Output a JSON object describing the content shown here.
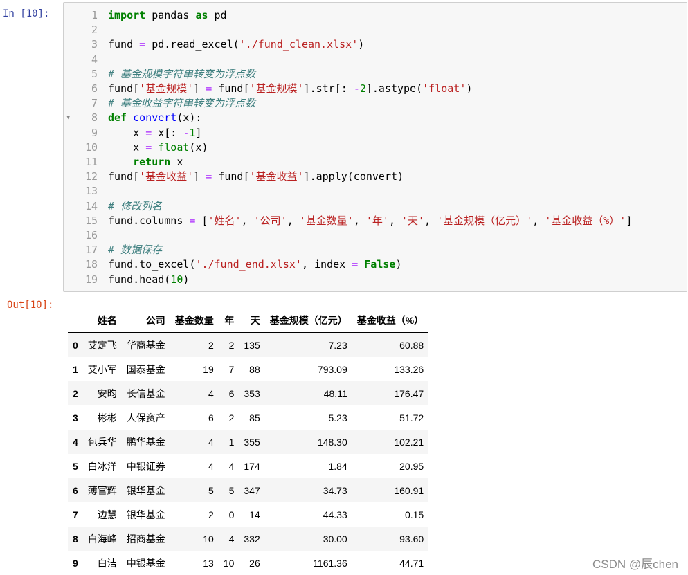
{
  "in_prompt": "In  [10]:",
  "out_prompt": "Out[10]:",
  "code_lines": [
    [
      {
        "t": "import",
        "c": "kw"
      },
      {
        "t": " pandas ",
        "c": "tx"
      },
      {
        "t": "as",
        "c": "kw"
      },
      {
        "t": " pd",
        "c": "tx"
      }
    ],
    [],
    [
      {
        "t": "fund ",
        "c": "tx"
      },
      {
        "t": "=",
        "c": "op"
      },
      {
        "t": " pd.read_excel(",
        "c": "tx"
      },
      {
        "t": "'./fund_clean.xlsx'",
        "c": "st"
      },
      {
        "t": ")",
        "c": "tx"
      }
    ],
    [],
    [
      {
        "t": "# 基金规模字符串转变为浮点数",
        "c": "cm"
      }
    ],
    [
      {
        "t": "fund[",
        "c": "tx"
      },
      {
        "t": "'基金规模'",
        "c": "st"
      },
      {
        "t": "] ",
        "c": "tx"
      },
      {
        "t": "=",
        "c": "op"
      },
      {
        "t": " fund[",
        "c": "tx"
      },
      {
        "t": "'基金规模'",
        "c": "st"
      },
      {
        "t": "].str[: ",
        "c": "tx"
      },
      {
        "t": "-",
        "c": "op"
      },
      {
        "t": "2",
        "c": "nm"
      },
      {
        "t": "].astype(",
        "c": "tx"
      },
      {
        "t": "'float'",
        "c": "st"
      },
      {
        "t": ")",
        "c": "tx"
      }
    ],
    [
      {
        "t": "# 基金收益字符串转变为浮点数",
        "c": "cm"
      }
    ],
    [
      {
        "t": "def",
        "c": "kw"
      },
      {
        "t": " ",
        "c": "tx"
      },
      {
        "t": "convert",
        "c": "fn"
      },
      {
        "t": "(x):",
        "c": "tx"
      }
    ],
    [
      {
        "t": "    x ",
        "c": "tx"
      },
      {
        "t": "=",
        "c": "op"
      },
      {
        "t": " x[: ",
        "c": "tx"
      },
      {
        "t": "-",
        "c": "op"
      },
      {
        "t": "1",
        "c": "nm"
      },
      {
        "t": "]",
        "c": "tx"
      }
    ],
    [
      {
        "t": "    x ",
        "c": "tx"
      },
      {
        "t": "=",
        "c": "op"
      },
      {
        "t": " ",
        "c": "tx"
      },
      {
        "t": "float",
        "c": "bi"
      },
      {
        "t": "(x)",
        "c": "tx"
      }
    ],
    [
      {
        "t": "    ",
        "c": "tx"
      },
      {
        "t": "return",
        "c": "kw"
      },
      {
        "t": " x",
        "c": "tx"
      }
    ],
    [
      {
        "t": "fund[",
        "c": "tx"
      },
      {
        "t": "'基金收益'",
        "c": "st"
      },
      {
        "t": "] ",
        "c": "tx"
      },
      {
        "t": "=",
        "c": "op"
      },
      {
        "t": " fund[",
        "c": "tx"
      },
      {
        "t": "'基金收益'",
        "c": "st"
      },
      {
        "t": "].apply(convert)",
        "c": "tx"
      }
    ],
    [],
    [
      {
        "t": "# 修改列名",
        "c": "cm"
      }
    ],
    [
      {
        "t": "fund.columns ",
        "c": "tx"
      },
      {
        "t": "=",
        "c": "op"
      },
      {
        "t": " [",
        "c": "tx"
      },
      {
        "t": "'姓名'",
        "c": "st"
      },
      {
        "t": ", ",
        "c": "tx"
      },
      {
        "t": "'公司'",
        "c": "st"
      },
      {
        "t": ", ",
        "c": "tx"
      },
      {
        "t": "'基金数量'",
        "c": "st"
      },
      {
        "t": ", ",
        "c": "tx"
      },
      {
        "t": "'年'",
        "c": "st"
      },
      {
        "t": ", ",
        "c": "tx"
      },
      {
        "t": "'天'",
        "c": "st"
      },
      {
        "t": ", ",
        "c": "tx"
      },
      {
        "t": "'基金规模（亿元）'",
        "c": "st"
      },
      {
        "t": ", ",
        "c": "tx"
      },
      {
        "t": "'基金收益（%）'",
        "c": "st"
      },
      {
        "t": "]",
        "c": "tx"
      }
    ],
    [],
    [
      {
        "t": "# 数据保存",
        "c": "cm"
      }
    ],
    [
      {
        "t": "fund.to_excel(",
        "c": "tx"
      },
      {
        "t": "'./fund_end.xlsx'",
        "c": "st"
      },
      {
        "t": ", index ",
        "c": "tx"
      },
      {
        "t": "=",
        "c": "op"
      },
      {
        "t": " ",
        "c": "tx"
      },
      {
        "t": "False",
        "c": "kw"
      },
      {
        "t": ")",
        "c": "tx"
      }
    ],
    [
      {
        "t": "fund.head(",
        "c": "tx"
      },
      {
        "t": "10",
        "c": "nm"
      },
      {
        "t": ")",
        "c": "tx"
      }
    ]
  ],
  "table": {
    "columns": [
      "",
      "姓名",
      "公司",
      "基金数量",
      "年",
      "天",
      "基金规模（亿元）",
      "基金收益（%）"
    ],
    "rows": [
      [
        "0",
        "艾定飞",
        "华商基金",
        "2",
        "2",
        "135",
        "7.23",
        "60.88"
      ],
      [
        "1",
        "艾小军",
        "国泰基金",
        "19",
        "7",
        "88",
        "793.09",
        "133.26"
      ],
      [
        "2",
        "安昀",
        "长信基金",
        "4",
        "6",
        "353",
        "48.11",
        "176.47"
      ],
      [
        "3",
        "彬彬",
        "人保资产",
        "6",
        "2",
        "85",
        "5.23",
        "51.72"
      ],
      [
        "4",
        "包兵华",
        "鹏华基金",
        "4",
        "1",
        "355",
        "148.30",
        "102.21"
      ],
      [
        "5",
        "白冰洋",
        "中银证券",
        "4",
        "4",
        "174",
        "1.84",
        "20.95"
      ],
      [
        "6",
        "薄官辉",
        "银华基金",
        "5",
        "5",
        "347",
        "34.73",
        "160.91"
      ],
      [
        "7",
        "边慧",
        "银华基金",
        "2",
        "0",
        "14",
        "44.33",
        "0.15"
      ],
      [
        "8",
        "白海峰",
        "招商基金",
        "10",
        "4",
        "332",
        "30.00",
        "93.60"
      ],
      [
        "9",
        "白洁",
        "中银基金",
        "13",
        "10",
        "26",
        "1161.36",
        "44.71"
      ]
    ]
  },
  "watermark": "CSDN @辰chen",
  "fold_icon": "chevron-down-icon"
}
